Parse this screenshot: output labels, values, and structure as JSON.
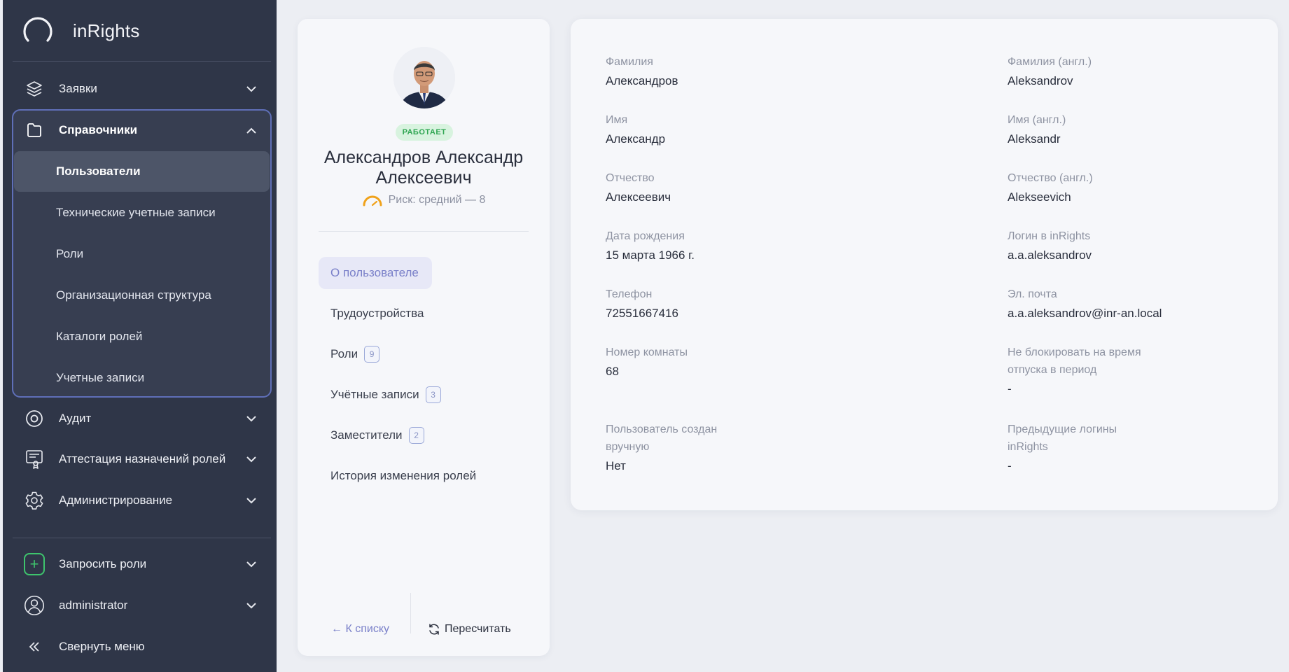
{
  "app": {
    "name": "inRights"
  },
  "sidebar": {
    "items": [
      {
        "label": "Заявки",
        "icon": "layers-icon"
      },
      {
        "label": "Справочники",
        "icon": "folder-icon",
        "expanded": true
      },
      {
        "label": "Аудит",
        "icon": "eye-icon"
      },
      {
        "label": "Аттестация назначений ролей",
        "icon": "certificate-icon"
      },
      {
        "label": "Администрирование",
        "icon": "gear-icon"
      }
    ],
    "sub_items": [
      {
        "label": "Пользователи",
        "active": true
      },
      {
        "label": "Технические учетные записи"
      },
      {
        "label": "Роли"
      },
      {
        "label": "Организационная структура"
      },
      {
        "label": "Каталоги ролей"
      },
      {
        "label": "Учетные записи"
      }
    ],
    "bottom": {
      "request_roles": "Запросить роли",
      "user": "administrator",
      "collapse": "Свернуть меню"
    }
  },
  "profile": {
    "status": "РАБОТАЕТ",
    "full_name": "Александров Александр Алексеевич",
    "risk": "Риск: средний — 8",
    "tabs": [
      {
        "label": "О пользователе",
        "active": true
      },
      {
        "label": "Трудоустройства"
      },
      {
        "label": "Роли",
        "count": "9"
      },
      {
        "label": "Учётные записи",
        "count": "3"
      },
      {
        "label": "Заместители",
        "count": "2"
      },
      {
        "label": "История изменения ролей"
      }
    ],
    "back": "← К списку",
    "recalc": "Пересчитать"
  },
  "details": {
    "last_name": {
      "label": "Фамилия",
      "value": "Александров"
    },
    "last_name_en": {
      "label": "Фамилия (англ.)",
      "value": "Aleksandrov"
    },
    "first_name": {
      "label": "Имя",
      "value": "Александр"
    },
    "first_name_en": {
      "label": "Имя (англ.)",
      "value": "Aleksandr"
    },
    "patronymic": {
      "label": "Отчество",
      "value": "Алексеевич"
    },
    "patronymic_en": {
      "label": "Отчество (англ.)",
      "value": "Alekseevich"
    },
    "birth_date": {
      "label": "Дата рождения",
      "value": "15 марта 1966 г."
    },
    "login": {
      "label": "Логин в inRights",
      "value": "a.a.aleksandrov"
    },
    "phone": {
      "label": "Телефон",
      "value": "72551667416"
    },
    "email": {
      "label": "Эл. почта",
      "value": "a.a.aleksandrov@inr-an.local"
    },
    "room": {
      "label": "Номер комнаты",
      "value": "68"
    },
    "no_block_line1": "Не блокировать на время",
    "no_block_line2": "отпуска в период",
    "no_block_value": "-",
    "created_manually_line1": "Пользователь создан",
    "created_manually_line2": "вручную",
    "created_manually_value": "Нет",
    "prev_logins_line1": "Предыдущие логины",
    "prev_logins_line2": "inRights",
    "prev_logins_value": "-"
  },
  "colors": {
    "sidebar_bg": "#2f3648",
    "accent": "#7a80c9",
    "status_green": "#2fa652",
    "risk_orange": "#f0a21a"
  }
}
